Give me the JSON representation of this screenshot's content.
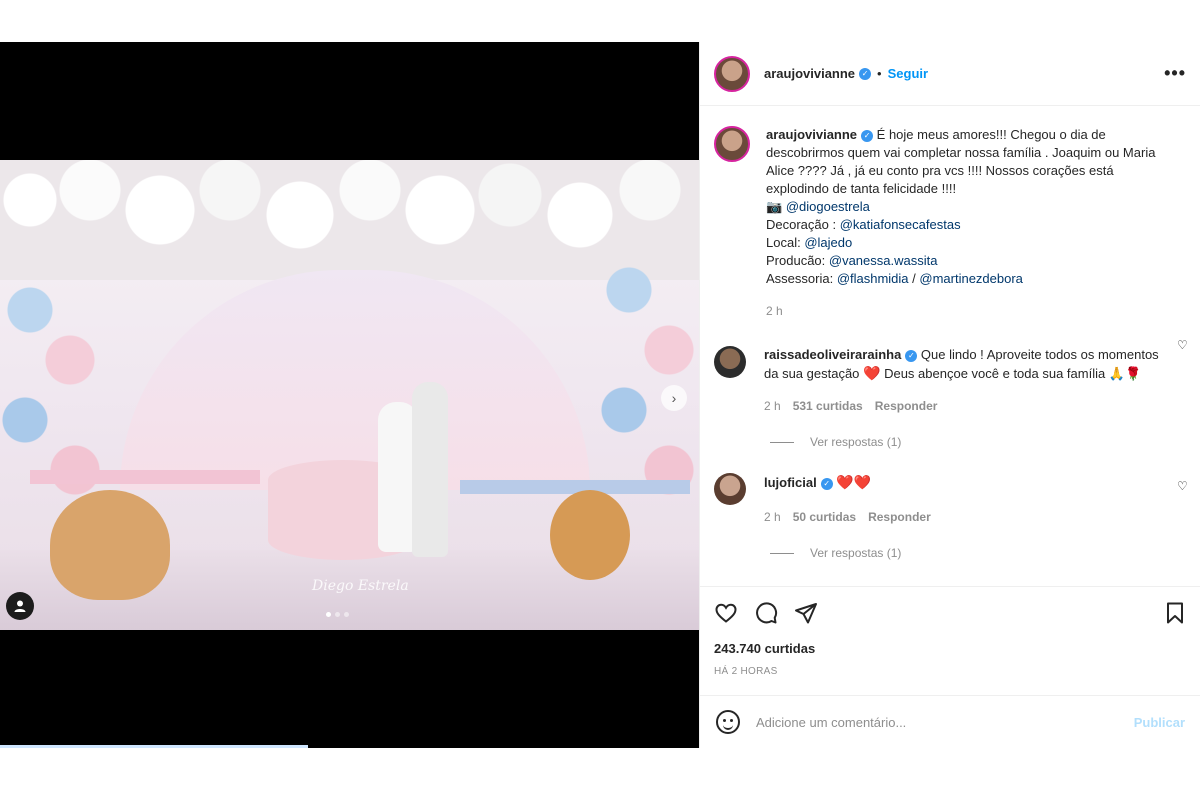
{
  "post": {
    "author": "araujovivianne",
    "follow_label": "Seguir",
    "separator": "•",
    "more_label": "•••",
    "photo_watermark": "Diego Estrela",
    "carousel_dots": 3
  },
  "caption": {
    "author": "araujovivianne",
    "line1": "É hoje meus amores!!! Chegou o dia de descobrirmos quem vai completar nossa família . Joaquim ou Maria Alice ???? Já , já eu conto pra vcs !!!! Nossos corações está explodindo de tanta felicidade !!!!",
    "camera_icon": "📷",
    "photo_credit": "@diogoestrela",
    "decor_label": "Decoração : ",
    "decor_mention": "@katiafonsecafestas",
    "local_label": "Local: ",
    "local_mention": "@lajedo",
    "production_label": "Producão: ",
    "production_mention": "@vanessa.wassita",
    "advisory_label": "Assessoria: ",
    "advisory_mention1": "@flashmidia",
    "advisory_sep": " / ",
    "advisory_mention2": "@martinezdebora",
    "time": "2 h"
  },
  "comments": [
    {
      "author": "raissadeoliveirarainha",
      "text_a": " Que lindo ! Aproveite todos os momentos da sua gestação ",
      "heart": "❤️",
      "text_b": " Deus abençoe você e toda sua família ",
      "emojis": "🙏🌹",
      "time": "2 h",
      "likes": "531 curtidas",
      "reply_label": "Responder",
      "view_replies": "Ver respostas (1)"
    },
    {
      "author": "lujoficial",
      "text_a": "",
      "heart": "❤️❤️",
      "time": "2 h",
      "likes": "50 curtidas",
      "reply_label": "Responder",
      "view_replies": "Ver respostas (1)"
    }
  ],
  "stats": {
    "likes": "243.740 curtidas",
    "posted": "HÁ 2 HORAS"
  },
  "composer": {
    "placeholder": "Adicione um comentário...",
    "publish_label": "Publicar"
  },
  "colors": {
    "link": "#00376b",
    "accent": "#0095f6",
    "heart": "#ed4956"
  }
}
